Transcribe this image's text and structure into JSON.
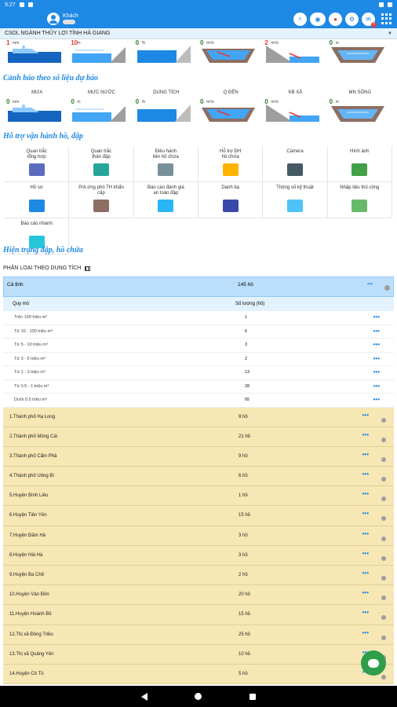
{
  "status": {
    "time": "9:27"
  },
  "header": {
    "user": "Khách",
    "badge_notify": "0"
  },
  "unit_select": "CSDL NGÀNH THỦY LỢI TỈNH HÀ GIANG",
  "top_cards": [
    {
      "value": "1",
      "unit": "mm",
      "red": true
    },
    {
      "value": "10",
      "unit": "m",
      "red": true
    },
    {
      "value": "0",
      "unit": "%",
      "red": false
    },
    {
      "value": "0",
      "unit": "m³/s",
      "red": false
    },
    {
      "value": "2",
      "unit": "m³/s",
      "red": true
    },
    {
      "value": "0",
      "unit": "m",
      "red": false
    }
  ],
  "section_warning": "Cảnh báo theo số liệu dự báo",
  "forecast_cards": [
    {
      "title": "MƯA",
      "value": "0",
      "unit": "mm",
      "red": false
    },
    {
      "title": "MỰC NƯỚC",
      "value": "0",
      "unit": "m",
      "red": false
    },
    {
      "title": "DUNG TÍCH",
      "value": "0",
      "unit": "%",
      "red": false
    },
    {
      "title": "Q ĐẾN",
      "value": "0",
      "unit": "m³/s",
      "red": false
    },
    {
      "title": "KB XẢ",
      "value": "0",
      "unit": "m³/s",
      "red": false
    },
    {
      "title": "MN SÔNG",
      "value": "0",
      "unit": "m",
      "red": false
    }
  ],
  "section_support": "Hỗ trợ vận hành hồ, đập",
  "tools": [
    {
      "label": "Quan trắc\ntổng hợp",
      "color": "#5c6bc0"
    },
    {
      "label": "Quan trắc\nthân đập",
      "color": "#26a69a"
    },
    {
      "label": "Điều hành\nliên hồ chứa",
      "color": "#78909c"
    },
    {
      "label": "Hỗ trợ ĐH\nhồ chứa",
      "color": "#ffb300"
    },
    {
      "label": "Camera",
      "color": "#455a64"
    },
    {
      "label": "Hình ảnh",
      "color": "#43a047"
    },
    {
      "label": "Hồ sơ",
      "color": "#1e88e5"
    },
    {
      "label": "P/A ứng phó TH khẩn\ncấp",
      "color": "#8d6e63"
    },
    {
      "label": "Báo cáo đánh giá\nan toàn đập",
      "color": "#29b6f6"
    },
    {
      "label": "Danh bạ",
      "color": "#3949ab"
    },
    {
      "label": "Thông số kỹ thuật",
      "color": "#4fc3f7"
    },
    {
      "label": "Nhập liệu thủ công",
      "color": "#66bb6a"
    },
    {
      "label": "Báo cáo nhanh",
      "color": "#26c6da"
    }
  ],
  "section_status": "Hiện trạng đập, hồ chứa",
  "classify_label": "PHÂN LOẠI THEO DUNG TÍCH",
  "table": {
    "head_label": "Cả tỉnh",
    "head_value": "145 hồ",
    "col_scale": "Quy mô",
    "col_count": "Số lượng (hồ)",
    "rows": [
      {
        "label": "Trên 100 triệu m³",
        "count": "1"
      },
      {
        "label": "Từ 10 - 100 triệu m³",
        "count": "6"
      },
      {
        "label": "Từ 5 - 10 triệu m³",
        "count": "3"
      },
      {
        "label": "Từ 3 - 5 triệu m³",
        "count": "2"
      },
      {
        "label": "Từ 1 - 3 triệu m³",
        "count": "13"
      },
      {
        "label": "Từ 0.5 - 1 triệu m³",
        "count": "28"
      },
      {
        "label": "Dưới 0.5 triệu m³",
        "count": "65"
      }
    ],
    "units": [
      {
        "name": "1.Thành phố Hạ Long",
        "count": "9 hồ"
      },
      {
        "name": "2.Thành phố Móng Cái",
        "count": "21 hồ"
      },
      {
        "name": "3.Thành phố Cẩm Phả",
        "count": "9 hồ"
      },
      {
        "name": "4.Thành phố Uông Bí",
        "count": "6 hồ"
      },
      {
        "name": "5.Huyện Bình Liêu",
        "count": "1 hồ"
      },
      {
        "name": "6.Huyện Tiên Yên",
        "count": "15 hồ"
      },
      {
        "name": "7.Huyện Đầm Hà",
        "count": "3 hồ"
      },
      {
        "name": "8.Huyện Hải Hà",
        "count": "3 hồ"
      },
      {
        "name": "9.Huyện Ba Chẽ",
        "count": "2 hồ"
      },
      {
        "name": "10.Huyện Vân Đồn",
        "count": "20 hồ"
      },
      {
        "name": "11.Huyện Hoành Bồ",
        "count": "15 hồ"
      },
      {
        "name": "12.Thị xã Đông Triều",
        "count": "25 hồ"
      },
      {
        "name": "13.Thị xã Quảng Yên",
        "count": "10 hồ"
      },
      {
        "name": "14.Huyện Cô Tô",
        "count": "5 hồ"
      }
    ]
  },
  "colors": {
    "primary": "#1e88e5",
    "ok": "#2e7d32",
    "alert": "#e53935",
    "unit_row": "#f7e7b4"
  }
}
